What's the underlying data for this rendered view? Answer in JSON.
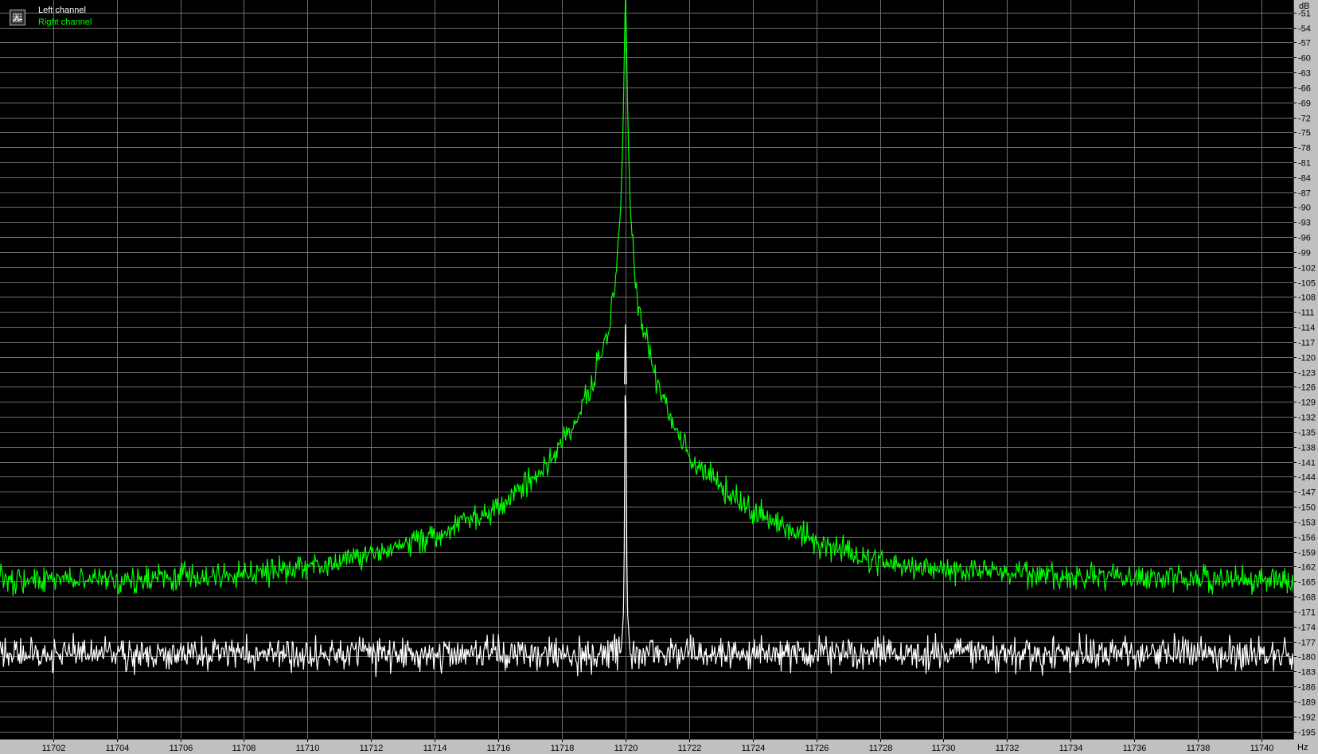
{
  "chart_data": {
    "type": "line",
    "xlabel": "",
    "ylabel": "",
    "x_unit": "Hz",
    "y_unit": "dB",
    "xlim": [
      11700.33,
      11741.0
    ],
    "ylim": [
      -196.5,
      -48.5
    ],
    "x_ticks": [
      11702,
      11704,
      11706,
      11708,
      11710,
      11712,
      11714,
      11716,
      11718,
      11720,
      11722,
      11724,
      11726,
      11728,
      11730,
      11732,
      11734,
      11736,
      11738,
      11740
    ],
    "y_ticks": [
      -51,
      -54,
      -57,
      -60,
      -63,
      -66,
      -69,
      -72,
      -75,
      -78,
      -81,
      -84,
      -87,
      -90,
      -93,
      -96,
      -99,
      -102,
      -105,
      -108,
      -111,
      -114,
      -117,
      -120,
      -123,
      -126,
      -129,
      -132,
      -135,
      -138,
      -141,
      -144,
      -147,
      -150,
      -153,
      -156,
      -159,
      -162,
      -165,
      -168,
      -171,
      -174,
      -177,
      -180,
      -183,
      -186,
      -189,
      -192,
      -195
    ],
    "grid": true,
    "legend_position": "top-left",
    "background_color": "#000000",
    "grid_color": "#6e6e6e",
    "series": [
      {
        "name": "Left channel",
        "color": "#ffffff",
        "x": [
          11700.4,
          11705,
          11710,
          11715,
          11719.5,
          11719.85,
          11719.95,
          11720.0,
          11720.05,
          11720.15,
          11720.5,
          11725,
          11730,
          11735,
          11741
        ],
        "values": [
          -179.5,
          -179.5,
          -179.5,
          -179.5,
          -179.5,
          -179.5,
          -170.0,
          -113.5,
          -170.0,
          -179.5,
          -179.5,
          -179.5,
          -179.5,
          -179.5,
          -179.5
        ]
      },
      {
        "name": "Right channel",
        "color": "#00ff00",
        "x": [
          11700.4,
          11704,
          11708,
          11710,
          11712,
          11714,
          11716,
          11717,
          11718,
          11718.5,
          11719,
          11719.5,
          11719.7,
          11719.85,
          11719.92,
          11719.97,
          11720.0,
          11720.03,
          11720.08,
          11720.15,
          11720.3,
          11720.5,
          11721,
          11721.5,
          11722,
          11723,
          11724,
          11726,
          11728,
          11730,
          11734,
          11738,
          11741
        ],
        "values": [
          -165.0,
          -164.5,
          -163.5,
          -162.0,
          -159.5,
          -156.0,
          -150.0,
          -145.0,
          -138.0,
          -132.0,
          -124.0,
          -113.0,
          -104.0,
          -90.0,
          -75.0,
          -57.0,
          -47.0,
          -57.0,
          -75.0,
          -90.0,
          -104.0,
          -113.0,
          -125.0,
          -133.0,
          -140.0,
          -146.0,
          -151.0,
          -157.0,
          -161.0,
          -162.5,
          -164.0,
          -164.5,
          -165.0
        ]
      }
    ]
  }
}
